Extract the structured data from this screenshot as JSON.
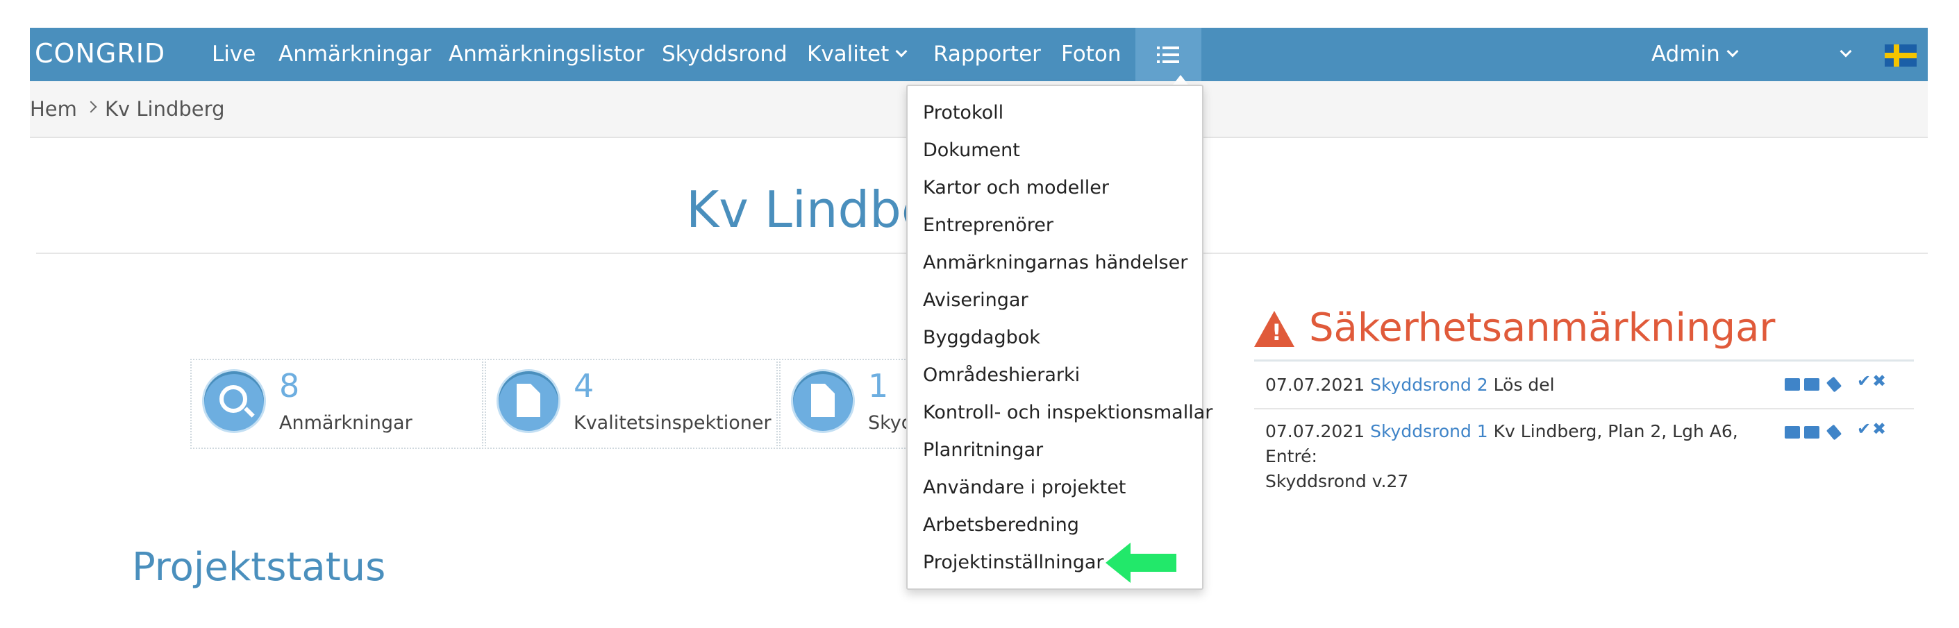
{
  "navbar": {
    "logo": "CONGRID",
    "items": [
      "Live",
      "Anmärkningar",
      "Anmärkningslistor",
      "Skyddsrond",
      "Kvalitet",
      "Rapporter",
      "Foton"
    ],
    "user": "Admin"
  },
  "breadcrumb": {
    "home": "Hem",
    "current": "Kv Lindberg"
  },
  "page": {
    "title": "Kv Lindberg 123456"
  },
  "stats": [
    {
      "value": "8",
      "label": "Anmärkningar",
      "icon": "search-icon"
    },
    {
      "value": "4",
      "label": "Kvalitetsinspektioner",
      "icon": "document-icon"
    },
    {
      "value": "1",
      "label": "Skyddsronder",
      "icon": "document-icon"
    }
  ],
  "safety": {
    "title": "Säkerhetsanmärkningar",
    "rows": [
      {
        "date": "07.07.2021",
        "link": "Skyddsrond 2",
        "text": "Lös del",
        "text2": ""
      },
      {
        "date": "07.07.2021",
        "link": "Skyddsrond 1",
        "text": "Kv Lindberg, Plan 2, Lgh A6, Entré:",
        "text2": "Skyddsrond v.27"
      }
    ]
  },
  "projektstatus": {
    "title": "Projektstatus"
  },
  "dropdown": {
    "items": [
      "Protokoll",
      "Dokument",
      "Kartor och modeller",
      "Entreprenörer",
      "Anmärkningarnas händelser",
      "Aviseringar",
      "Byggdagbok",
      "Områdeshierarki",
      "Kontroll- och inspektionsmallar",
      "Planritningar",
      "Användare i projektet",
      "Arbetsberedning",
      "Projektinställningar"
    ]
  },
  "colors": {
    "nav": "#4a8fbd",
    "accent": "#6daee0",
    "danger": "#e05a3a",
    "annotation": "#22e86a"
  }
}
